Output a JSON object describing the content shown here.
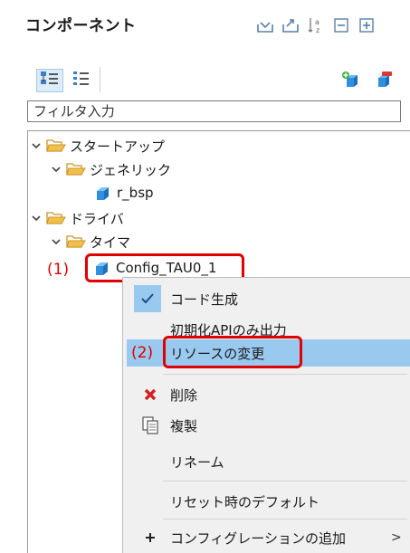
{
  "panel": {
    "title": "コンポーネント",
    "header_icons": [
      "collapse-icon",
      "expand-icon",
      "sort-az-icon",
      "minimize-icon",
      "maximize-icon"
    ]
  },
  "toolbar": {
    "buttons": [
      "tree-view-icon",
      "flat-view-icon",
      "add-component-icon",
      "delete-component-icon"
    ]
  },
  "filter": {
    "placeholder": "フィルタ入力",
    "value": ""
  },
  "tree": {
    "nodes": [
      {
        "label": "スタートアップ",
        "type": "folder",
        "level": 0,
        "expanded": true
      },
      {
        "label": "ジェネリック",
        "type": "folder",
        "level": 1,
        "expanded": true
      },
      {
        "label": "r_bsp",
        "type": "component",
        "level": 2
      },
      {
        "label": "ドライバ",
        "type": "folder",
        "level": 0,
        "expanded": true
      },
      {
        "label": "タイマ",
        "type": "folder",
        "level": 1,
        "expanded": true
      },
      {
        "label": "Config_TAU0_1",
        "type": "component",
        "level": 2,
        "selected": true
      }
    ]
  },
  "annotations": {
    "step1": "(1)",
    "step2": "(2)"
  },
  "context_menu": {
    "items": [
      {
        "label": "コード生成",
        "icon": "check-icon",
        "checked": true
      },
      {
        "label": "初期化APIのみ出力"
      },
      {
        "label": "リソースの変更",
        "highlighted": true
      },
      {
        "label": "削除",
        "icon": "delete-x-icon"
      },
      {
        "label": "複製",
        "icon": "copy-icon"
      },
      {
        "label": "リネーム"
      },
      {
        "label": "リセット時のデフォルト"
      },
      {
        "label": "コンフィグレーションの追加",
        "icon": "plus-icon",
        "submenu": true
      }
    ]
  },
  "colors": {
    "highlight": "#99c9ef",
    "annotation_red": "#e00000",
    "menu_bg": "#f0f0f0",
    "folder": "#f2c04a",
    "component": "#2f8fde"
  }
}
